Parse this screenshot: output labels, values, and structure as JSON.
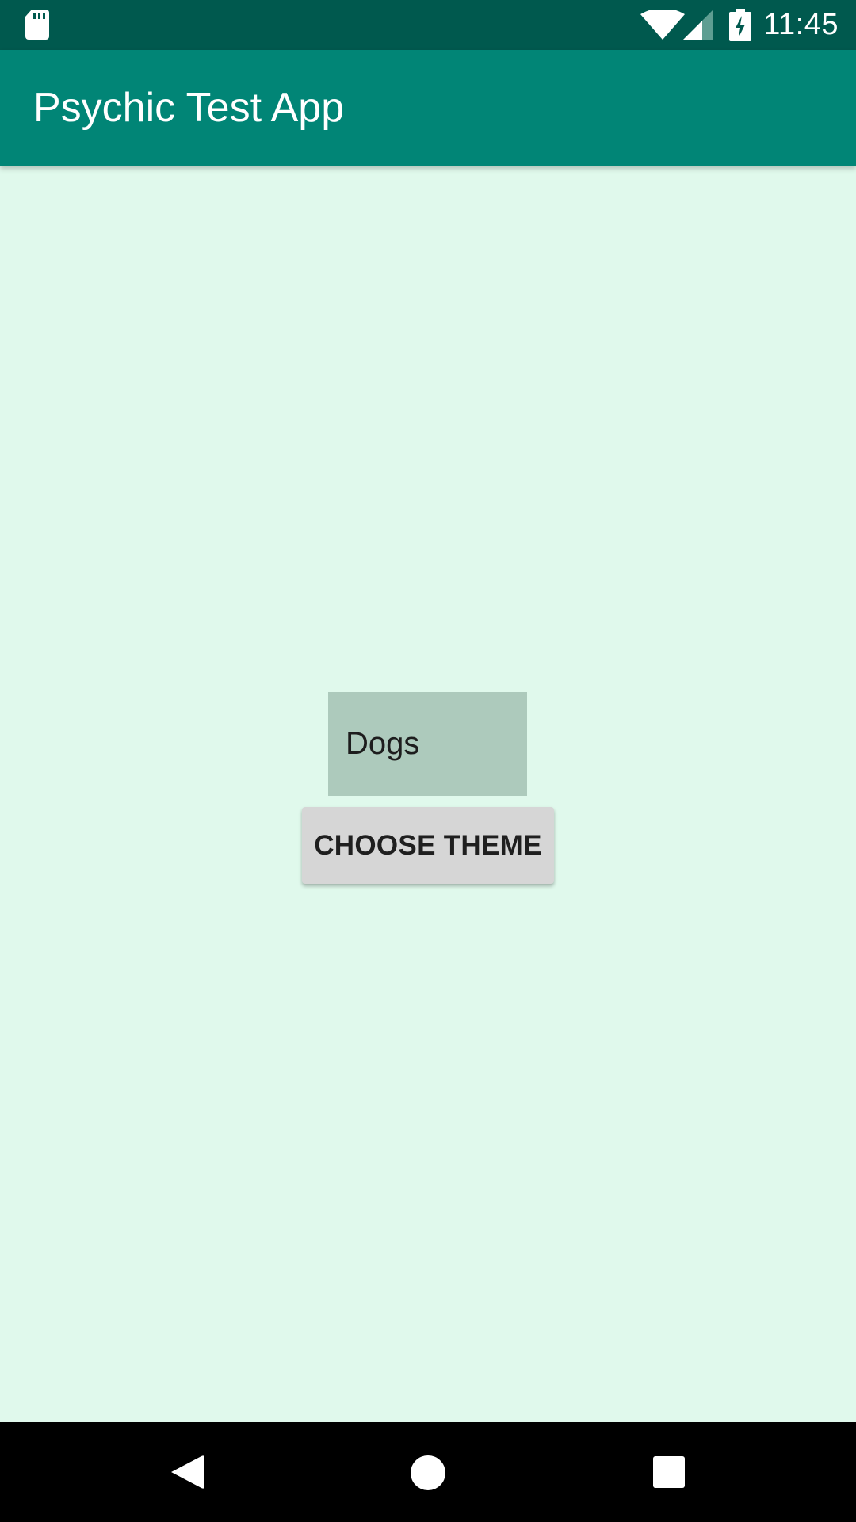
{
  "status_bar": {
    "time": "11:45",
    "icons": [
      "sd-card-icon",
      "wifi-icon",
      "signal-icon",
      "battery-charging-icon"
    ]
  },
  "app_bar": {
    "title": "Psychic Test App",
    "color": "#018576"
  },
  "main": {
    "theme_value": "Dogs",
    "choose_button_label": "CHOOSE THEME",
    "background_color": "#e0f9ec"
  },
  "nav_bar": {
    "icons": [
      "back-icon",
      "home-icon",
      "recents-icon"
    ]
  }
}
